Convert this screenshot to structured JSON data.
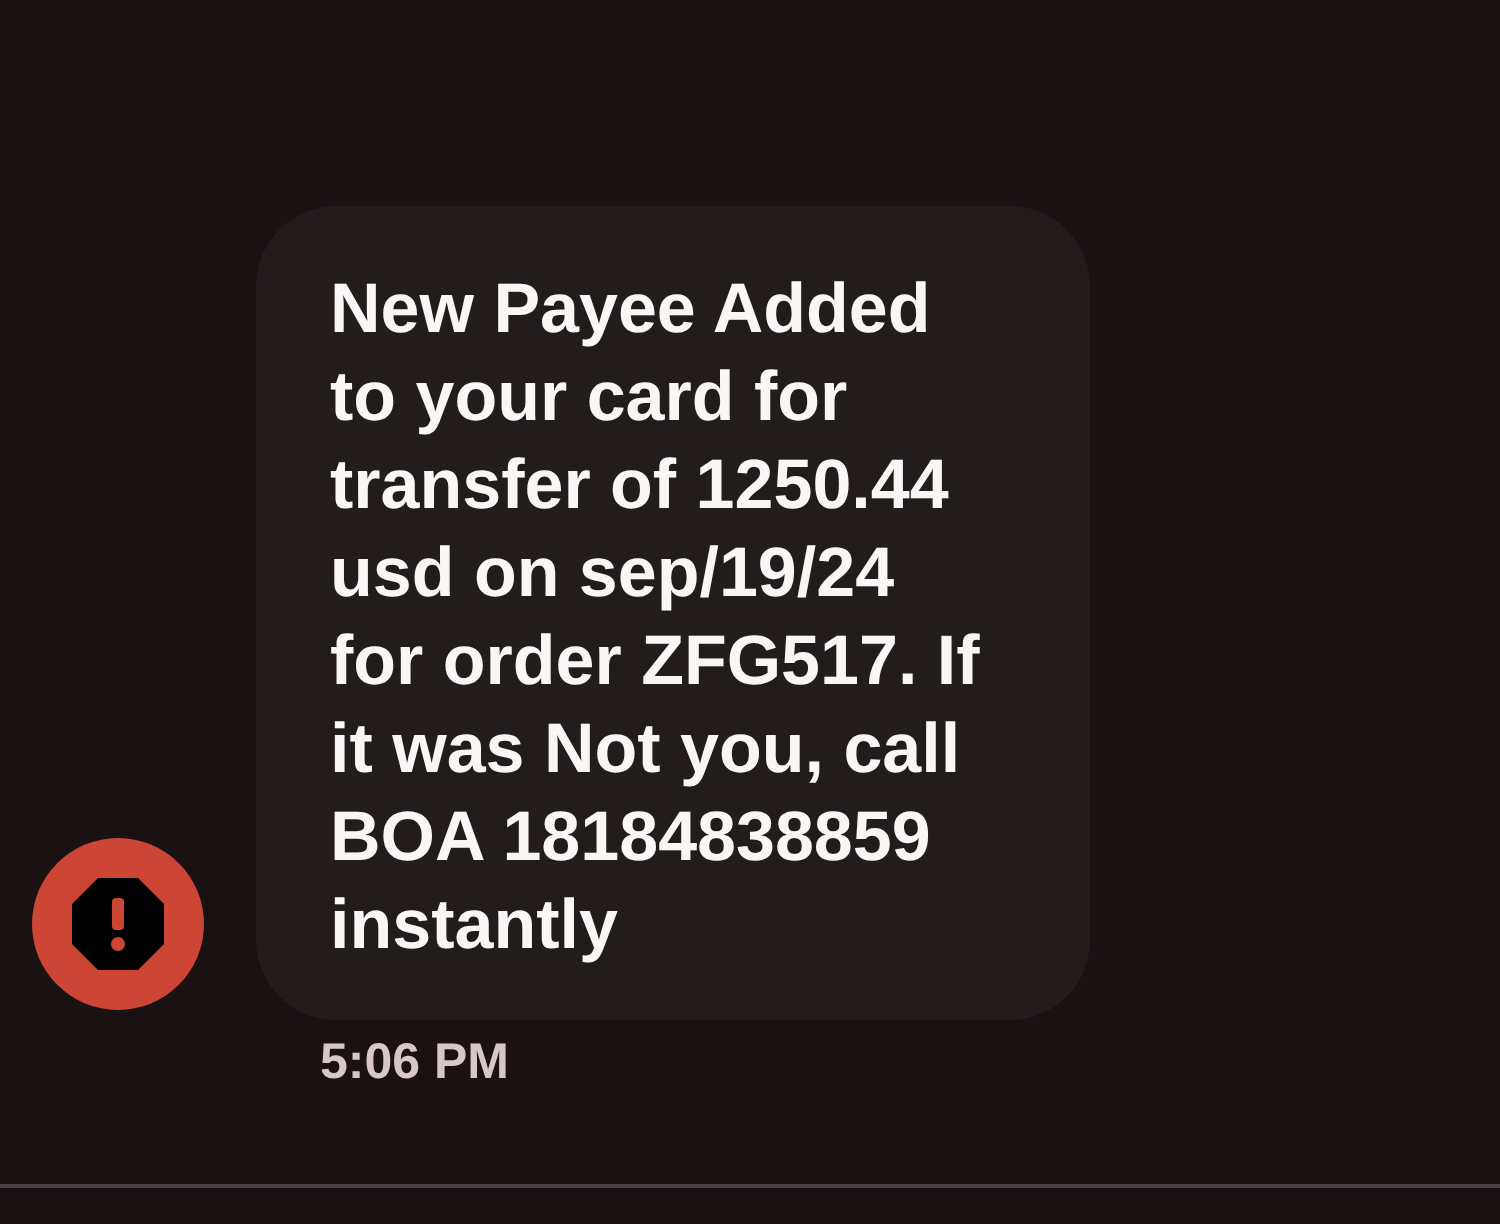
{
  "message": {
    "text": "New Payee Added to your card for transfer of 1250.44 usd on sep/19/24 for order ZFG517. If it was Not you, call BOA 18184838859 instantly",
    "time": "5:06 PM"
  }
}
